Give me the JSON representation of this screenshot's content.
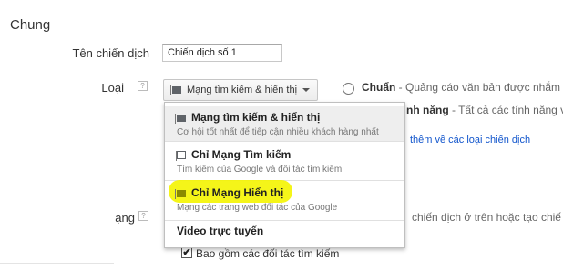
{
  "section": {
    "title": "Chung"
  },
  "campaign_name": {
    "label": "Tên chiến dịch",
    "value": "Chiến dịch số 1"
  },
  "type": {
    "label": "Loại",
    "help": "?",
    "dropdown_value": "Mạng tìm kiếm & hiển thị",
    "options": [
      {
        "title": "Mạng tìm kiếm & hiển thị",
        "subtitle": "Cơ hội tốt nhất để tiếp cận nhiều khách hàng nhất",
        "icon": "display-network-icon"
      },
      {
        "title": "Chỉ Mạng Tìm kiếm",
        "subtitle": "Tìm kiếm của Google và đối tác tìm kiếm",
        "icon": "search-network-icon"
      },
      {
        "title": "Chỉ Mạng Hiển thị",
        "subtitle": "Mạng các trang web đối tác của Google",
        "icon": "display-network-icon"
      },
      {
        "title": "Video trực tuyến",
        "subtitle": "",
        "icon": ""
      }
    ]
  },
  "subtype": {
    "standard_label": "Chuẩn",
    "standard_desc": " - Quảng cáo văn bản được nhắm",
    "all_features_label": "nh năng",
    "all_features_desc": " - Tất cả các tính năng và",
    "learn_more": "thêm về các loại chiến dịch"
  },
  "networks": {
    "label": "ạng",
    "help": "?",
    "partial_text": "chiến dịch ở trên hoặc tạo chiế",
    "include_partners": "Bao gồm các đối tác tìm kiếm",
    "include_partners_checked": true,
    "checkmark": "✔"
  },
  "colors": {
    "highlight": "#f4f400",
    "link": "#1155cc"
  }
}
